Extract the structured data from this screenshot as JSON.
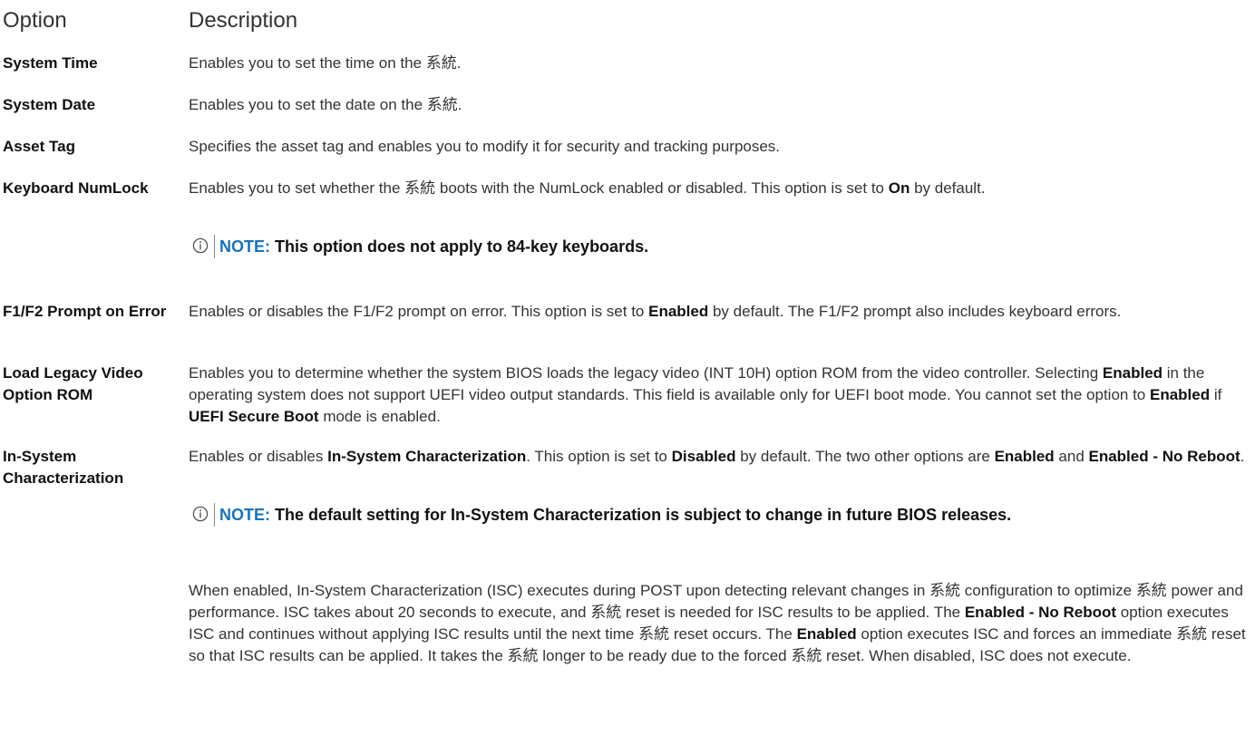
{
  "header": {
    "option": "Option",
    "description": "Description"
  },
  "rows": [
    {
      "option": "System Time",
      "description": "Enables you to set the time on the 系統."
    },
    {
      "option": "System Date",
      "description": "Enables you to set the date on the 系統."
    },
    {
      "option": "Asset Tag",
      "description": "Specifies the asset tag and enables you to modify it for security and tracking purposes."
    },
    {
      "option": "Keyboard NumLock",
      "desc_1": "Enables you to set whether the 系統 boots with the NumLock enabled or disabled. This option is set to ",
      "desc_b1": "On",
      "desc_2": " by default.",
      "note_label": "NOTE:",
      "note_text": " This option does not apply to 84-key keyboards."
    },
    {
      "option": "F1/F2 Prompt on Error",
      "desc_1": "Enables or disables the F1/F2 prompt on error. This option is set to ",
      "desc_b1": "Enabled",
      "desc_2": " by default. The F1/F2 prompt also includes keyboard errors."
    },
    {
      "option": "Load Legacy Video Option ROM",
      "desc_1": "Enables you to determine whether the system BIOS loads the legacy video (INT 10H) option ROM from the video controller. Selecting ",
      "desc_b1": "Enabled",
      "desc_2": " in the operating system does not support UEFI video output standards. This field is available only for UEFI boot mode. You cannot set the option to ",
      "desc_b2": "Enabled",
      "desc_3": " if ",
      "desc_b3": "UEFI Secure Boot",
      "desc_4": " mode is enabled."
    },
    {
      "option": "In-System Characterization",
      "desc_1": "Enables or disables ",
      "desc_b1": "In-System Characterization",
      "desc_2": ". This option is set to ",
      "desc_b2": "Disabled",
      "desc_3": " by default. The two other options are ",
      "desc_b3": "Enabled",
      "desc_4": " and ",
      "desc_b4": "Enabled - No Reboot",
      "desc_5": ".",
      "note_label": "NOTE:",
      "note_text": " The default setting for In-System Characterization is subject to change in future BIOS releases.",
      "para_1": "When enabled, In-System Characterization (ISC) executes during POST upon detecting relevant changes in 系統 configuration to optimize 系統 power and performance. ISC takes about 20 seconds to execute, and 系統 reset is needed for ISC results to be applied. The ",
      "para_b1": "Enabled - No Reboot",
      "para_2": " option executes ISC and continues without applying ISC results until the next time 系統 reset occurs. The ",
      "para_b2": "Enabled",
      "para_3": " option executes ISC and forces an immediate 系統 reset so that ISC results can be applied. It takes the 系統 longer to be ready due to the forced 系統 reset. When disabled, ISC does not execute."
    }
  ],
  "icons": {
    "note": "info-circle-icon"
  },
  "colors": {
    "note_label": "#1a73b8",
    "text": "#333333"
  }
}
